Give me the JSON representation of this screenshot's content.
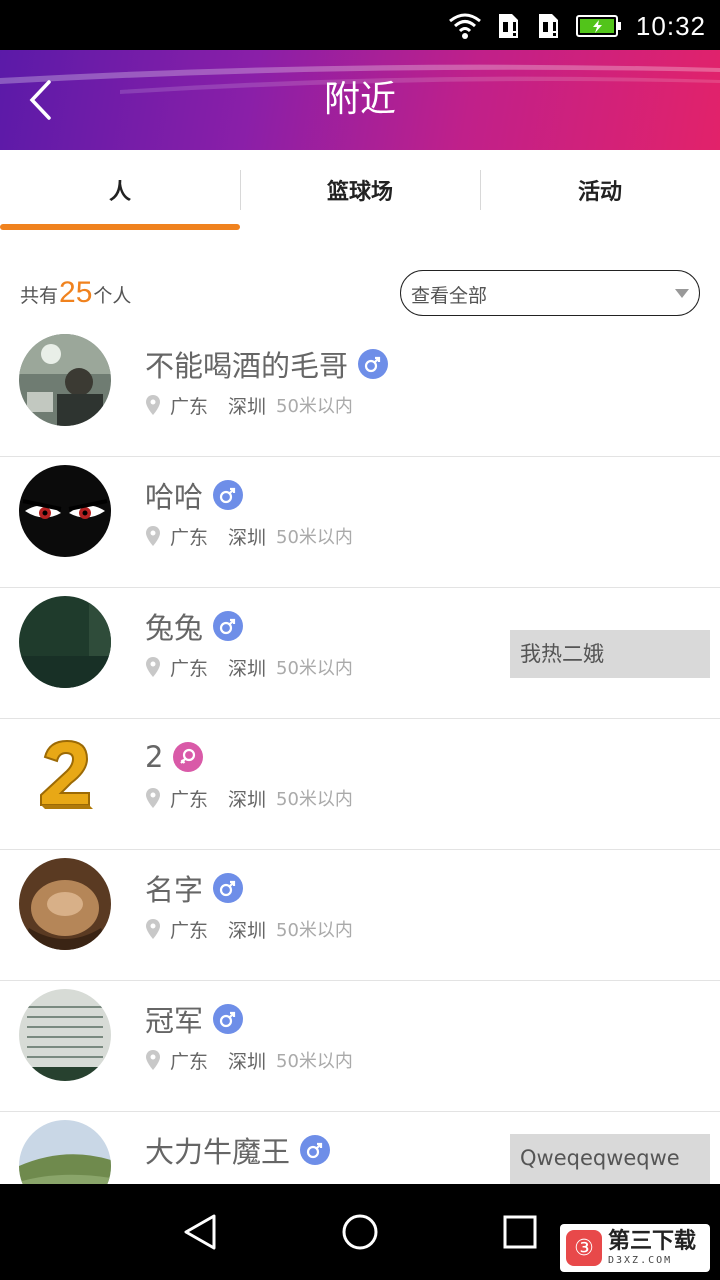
{
  "status_bar": {
    "time": "10:32"
  },
  "header": {
    "title": "附近",
    "back_icon": "chevron-left-icon"
  },
  "tabs": [
    {
      "label": "人",
      "active": true
    },
    {
      "label": "篮球场",
      "active": false
    },
    {
      "label": "活动",
      "active": false
    }
  ],
  "summary": {
    "prefix": "共有",
    "count": "25",
    "suffix": "个人"
  },
  "filter": {
    "selected": "查看全部"
  },
  "people": [
    {
      "name": "不能喝酒的毛哥",
      "gender": "male",
      "province": "广东",
      "city": "深圳",
      "distance": "50米以内",
      "signature": ""
    },
    {
      "name": "哈哈",
      "gender": "male",
      "province": "广东",
      "city": "深圳",
      "distance": "50米以内",
      "signature": ""
    },
    {
      "name": "兔兔",
      "gender": "male",
      "province": "广东",
      "city": "深圳",
      "distance": "50米以内",
      "signature": "我热二娥"
    },
    {
      "name": "2",
      "gender": "female",
      "province": "广东",
      "city": "深圳",
      "distance": "50米以内",
      "signature": ""
    },
    {
      "name": "名字",
      "gender": "male",
      "province": "广东",
      "city": "深圳",
      "distance": "50米以内",
      "signature": ""
    },
    {
      "name": "冠军",
      "gender": "male",
      "province": "广东",
      "city": "深圳",
      "distance": "50米以内",
      "signature": ""
    },
    {
      "name": "大力牛魔王",
      "gender": "male",
      "province": "",
      "city": "",
      "distance": "",
      "signature": "Qweqeqweqwe"
    }
  ],
  "watermark": {
    "main": "第三下载",
    "sub": "D3XZ.COM"
  },
  "colors": {
    "accent": "#f0821e",
    "male": "#6e8ee8",
    "female": "#d95aa8",
    "header_start": "#5b1aa8",
    "header_end": "#e2226a"
  }
}
